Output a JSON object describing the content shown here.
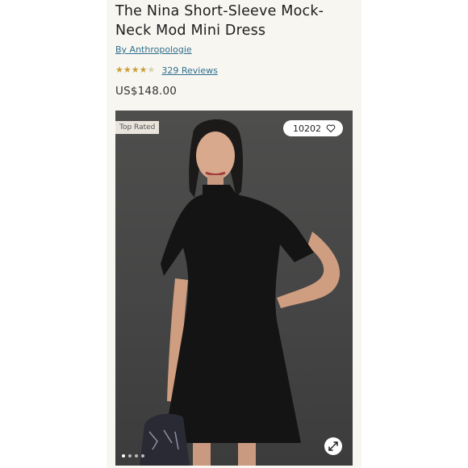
{
  "product": {
    "title": "The Nina Short-Sleeve Mock-Neck Mod Mini Dress",
    "brand_link": "By Anthropologie",
    "rating": 4.5,
    "rating_max": 5,
    "reviews_link": "329 Reviews",
    "price": "US$148.00"
  },
  "image": {
    "badge": "Top Rated",
    "likes_count": "10202",
    "carousel_dots": 4,
    "carousel_active_index": 0
  },
  "icons": {
    "like": "heart-icon",
    "expand": "expand-icon",
    "rating": "star-icon"
  },
  "colors": {
    "link": "#2f6f8d",
    "star": "#c9a13b",
    "panel_bg": "#f8f6f1"
  }
}
